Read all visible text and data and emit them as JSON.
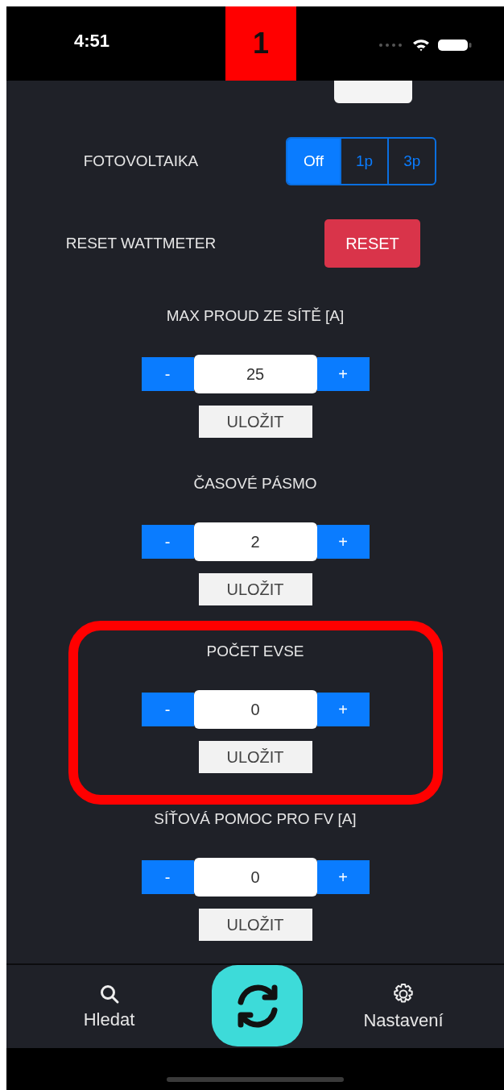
{
  "status_bar": {
    "time": "4:51"
  },
  "annotation": {
    "label": "1"
  },
  "settings": [
    {
      "kind": "segmented",
      "label": "FOTOVOLTAIKA",
      "options": [
        {
          "label": "Off",
          "selected": true
        },
        {
          "label": "1p",
          "selected": false
        },
        {
          "label": "3p",
          "selected": false
        }
      ]
    },
    {
      "kind": "button",
      "label": "RESET WATTMETER",
      "button": "RESET"
    },
    {
      "kind": "stepper",
      "label": "MAX PROUD ZE SÍTĚ [A]",
      "minus": "-",
      "value": "25",
      "plus": "+",
      "save": "ULOŽIT",
      "highlighted": false
    },
    {
      "kind": "stepper",
      "label": "ČASOVÉ PÁSMO",
      "minus": "-",
      "value": "2",
      "plus": "+",
      "save": "ULOŽIT",
      "highlighted": false
    },
    {
      "kind": "stepper",
      "label": "POČET EVSE",
      "minus": "-",
      "value": "0",
      "plus": "+",
      "save": "ULOŽIT",
      "highlighted": true
    },
    {
      "kind": "stepper",
      "label": "SÍŤOVÁ POMOC PRO FV [A]",
      "minus": "-",
      "value": "0",
      "plus": "+",
      "save": "ULOŽIT",
      "highlighted": false
    }
  ],
  "tab_bar": [
    {
      "kind": "search",
      "label": "Hledat"
    },
    {
      "kind": "refresh"
    },
    {
      "kind": "settings",
      "label": "Nastavení"
    }
  ]
}
